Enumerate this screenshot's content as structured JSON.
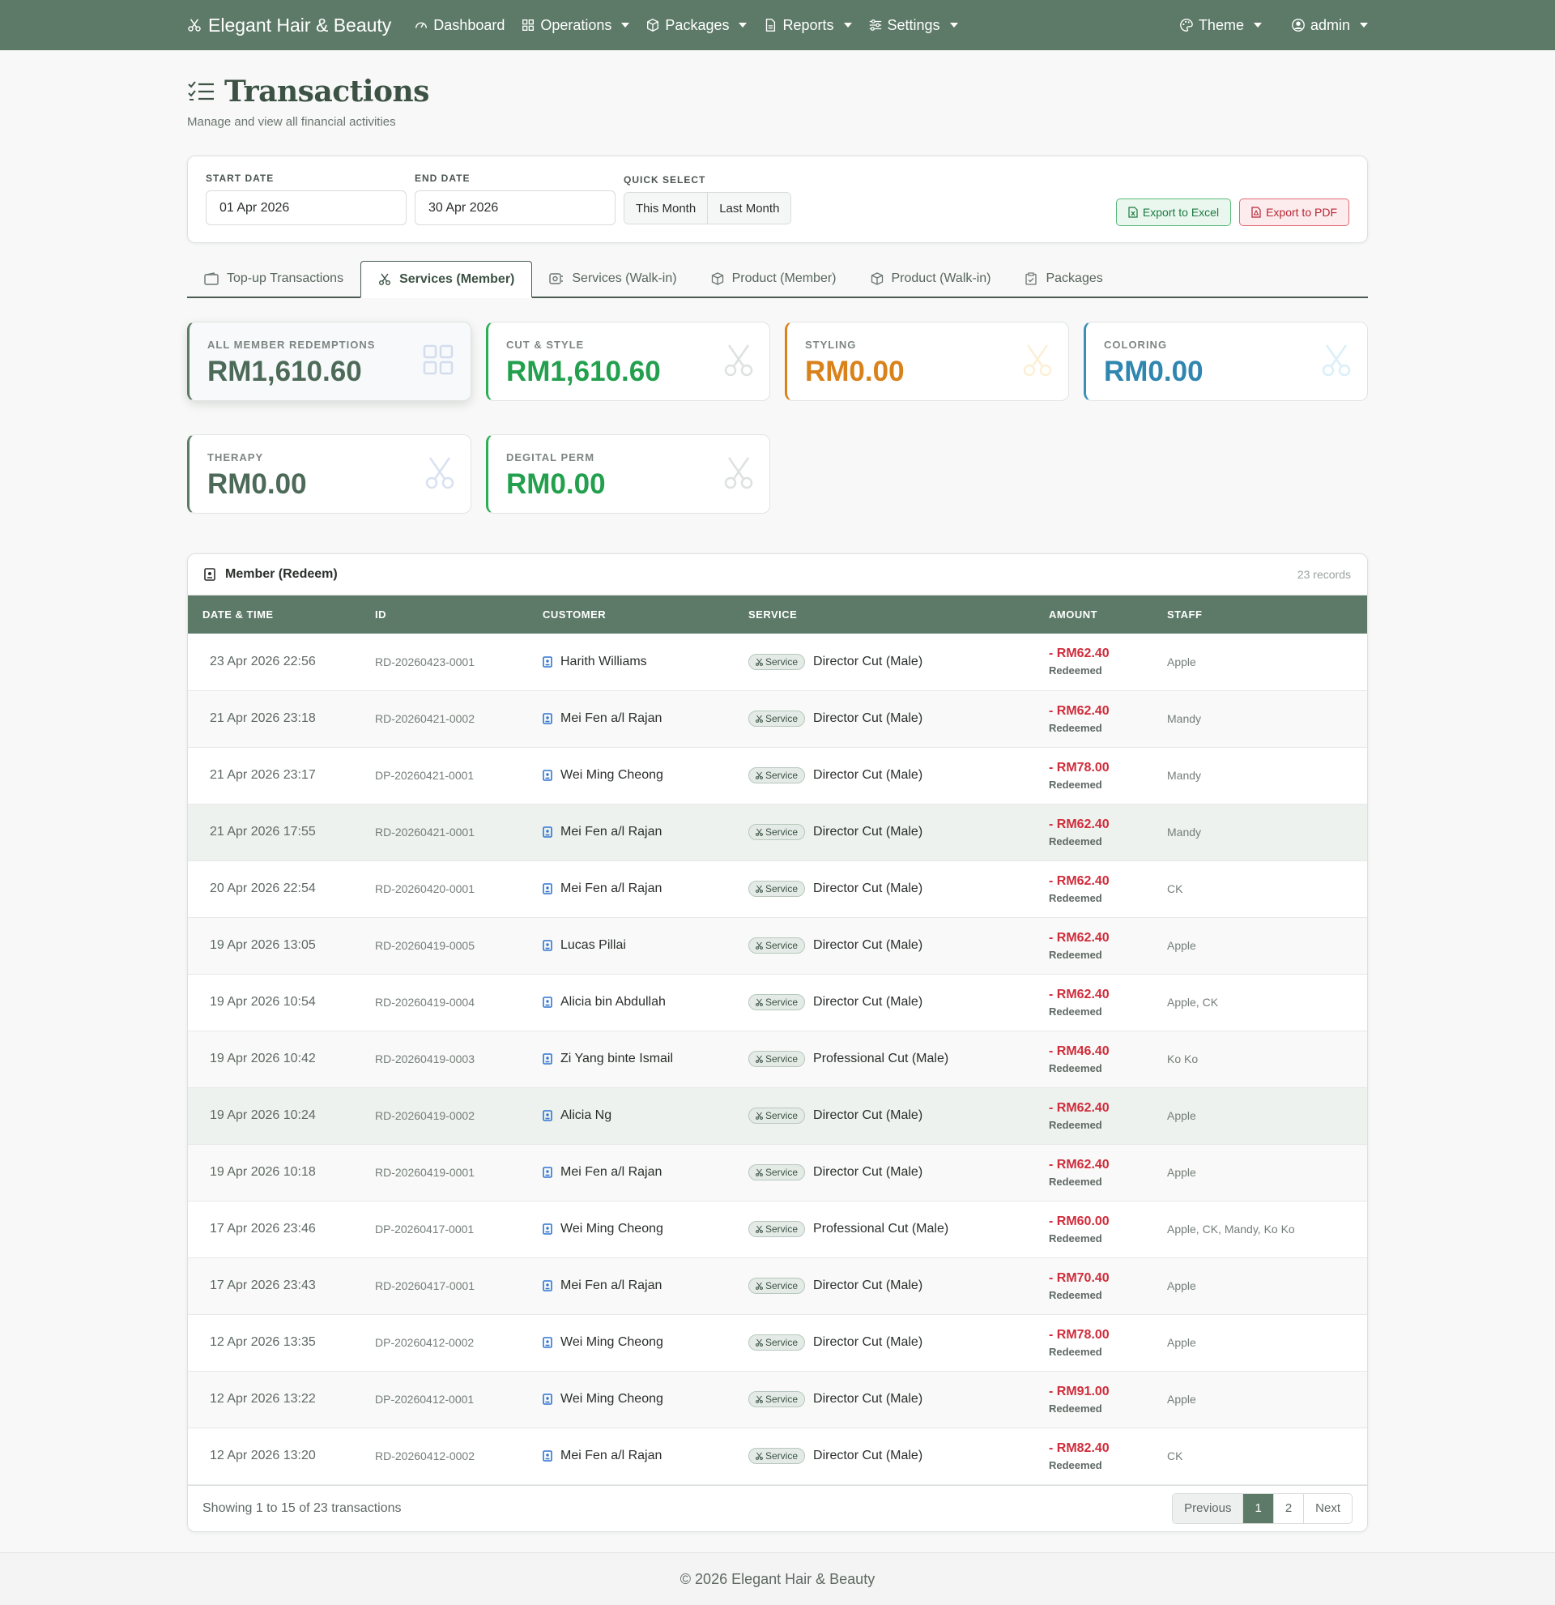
{
  "nav": {
    "brand": "Elegant Hair & Beauty",
    "items": [
      {
        "label": "Dashboard",
        "icon": "speedometer-icon",
        "dropdown": false
      },
      {
        "label": "Operations",
        "icon": "grid-icon",
        "dropdown": true
      },
      {
        "label": "Packages",
        "icon": "box-icon",
        "dropdown": true
      },
      {
        "label": "Reports",
        "icon": "document-icon",
        "dropdown": true
      },
      {
        "label": "Settings",
        "icon": "sliders-icon",
        "dropdown": true
      }
    ],
    "theme": "Theme",
    "user": "admin"
  },
  "page": {
    "title": "Transactions",
    "subtitle": "Manage and view all financial activities"
  },
  "filter": {
    "start_label": "START DATE",
    "start_value": "01 Apr 2026",
    "end_label": "END DATE",
    "end_value": "30 Apr 2026",
    "quick_label": "QUICK SELECT",
    "this_month": "This Month",
    "last_month": "Last Month",
    "export_excel": "Export to Excel",
    "export_pdf": "Export to PDF"
  },
  "tabs": [
    {
      "label": "Top-up Transactions",
      "icon": "wallet-icon",
      "active": false
    },
    {
      "label": "Services (Member)",
      "icon": "scissors-icon",
      "active": true
    },
    {
      "label": "Services (Walk-in)",
      "icon": "walk-in-icon",
      "active": false
    },
    {
      "label": "Product (Member)",
      "icon": "box-icon",
      "active": false
    },
    {
      "label": "Product (Walk-in)",
      "icon": "box-icon",
      "active": false
    },
    {
      "label": "Packages",
      "icon": "clipboard-icon",
      "active": false
    }
  ],
  "stats": [
    {
      "label": "ALL MEMBER REDEMPTIONS",
      "value": "RM1,610.60",
      "color": "#4d6a58"
    },
    {
      "label": "CUT & STYLE",
      "value": "RM1,610.60",
      "color": "#22a04d"
    },
    {
      "label": "STYLING",
      "value": "RM0.00",
      "color": "#d9821a"
    },
    {
      "label": "COLORING",
      "value": "RM0.00",
      "color": "#2f86b0"
    },
    {
      "label": "THERAPY",
      "value": "RM0.00",
      "color": "#4d6a58"
    },
    {
      "label": "DEGITAL PERM",
      "value": "RM0.00",
      "color": "#22a04d"
    }
  ],
  "table": {
    "title": "Member (Redeem)",
    "count": "23 records",
    "headers": [
      "DATE & TIME",
      "ID",
      "CUSTOMER",
      "SERVICE",
      "AMOUNT",
      "STAFF"
    ],
    "badge": "Service",
    "status": "Redeemed",
    "rows": [
      {
        "date": "23 Apr 2026 22:56",
        "id": "RD-20260423-0001",
        "customer": "Harith Williams",
        "service": "Director Cut (Male)",
        "amount": "- RM62.40",
        "staff": "Apple"
      },
      {
        "date": "21 Apr 2026 23:18",
        "id": "RD-20260421-0002",
        "customer": "Mei Fen a/l Rajan",
        "service": "Director Cut (Male)",
        "amount": "- RM62.40",
        "staff": "Mandy"
      },
      {
        "date": "21 Apr 2026 23:17",
        "id": "DP-20260421-0001",
        "customer": "Wei Ming Cheong",
        "service": "Director Cut (Male)",
        "amount": "- RM78.00",
        "staff": "Mandy"
      },
      {
        "date": "21 Apr 2026 17:55",
        "id": "RD-20260421-0001",
        "customer": "Mei Fen a/l Rajan",
        "service": "Director Cut (Male)",
        "amount": "- RM62.40",
        "staff": "Mandy"
      },
      {
        "date": "20 Apr 2026 22:54",
        "id": "RD-20260420-0001",
        "customer": "Mei Fen a/l Rajan",
        "service": "Director Cut (Male)",
        "amount": "- RM62.40",
        "staff": "CK"
      },
      {
        "date": "19 Apr 2026 13:05",
        "id": "RD-20260419-0005",
        "customer": "Lucas Pillai",
        "service": "Director Cut (Male)",
        "amount": "- RM62.40",
        "staff": "Apple"
      },
      {
        "date": "19 Apr 2026 10:54",
        "id": "RD-20260419-0004",
        "customer": "Alicia bin Abdullah",
        "service": "Director Cut (Male)",
        "amount": "- RM62.40",
        "staff": "Apple, CK"
      },
      {
        "date": "19 Apr 2026 10:42",
        "id": "RD-20260419-0003",
        "customer": "Zi Yang binte Ismail",
        "service": "Professional Cut (Male)",
        "amount": "- RM46.40",
        "staff": "Ko Ko"
      },
      {
        "date": "19 Apr 2026 10:24",
        "id": "RD-20260419-0002",
        "customer": "Alicia Ng",
        "service": "Director Cut (Male)",
        "amount": "- RM62.40",
        "staff": "Apple"
      },
      {
        "date": "19 Apr 2026 10:18",
        "id": "RD-20260419-0001",
        "customer": "Mei Fen a/l Rajan",
        "service": "Director Cut (Male)",
        "amount": "- RM62.40",
        "staff": "Apple"
      },
      {
        "date": "17 Apr 2026 23:46",
        "id": "DP-20260417-0001",
        "customer": "Wei Ming Cheong",
        "service": "Professional Cut (Male)",
        "amount": "- RM60.00",
        "staff": "Apple, CK, Mandy, Ko Ko"
      },
      {
        "date": "17 Apr 2026 23:43",
        "id": "RD-20260417-0001",
        "customer": "Mei Fen a/l Rajan",
        "service": "Director Cut (Male)",
        "amount": "- RM70.40",
        "staff": "Apple"
      },
      {
        "date": "12 Apr 2026 13:35",
        "id": "DP-20260412-0002",
        "customer": "Wei Ming Cheong",
        "service": "Director Cut (Male)",
        "amount": "- RM78.00",
        "staff": "Apple"
      },
      {
        "date": "12 Apr 2026 13:22",
        "id": "DP-20260412-0001",
        "customer": "Wei Ming Cheong",
        "service": "Director Cut (Male)",
        "amount": "- RM91.00",
        "staff": "Apple"
      },
      {
        "date": "12 Apr 2026 13:20",
        "id": "RD-20260412-0002",
        "customer": "Mei Fen a/l Rajan",
        "service": "Director Cut (Male)",
        "amount": "- RM82.40",
        "staff": "CK"
      }
    ],
    "footer_info": "Showing 1 to 15 of 23 transactions",
    "pager": {
      "prev": "Previous",
      "page1": "1",
      "page2": "2",
      "next": "Next"
    }
  },
  "footer": "© 2026 Elegant Hair & Beauty"
}
